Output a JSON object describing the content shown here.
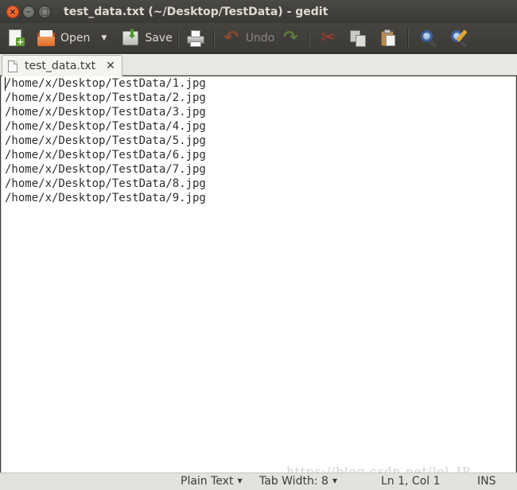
{
  "window": {
    "title": "test_data.txt (~/Desktop/TestData) - gedit",
    "close_glyph": "×",
    "minimize_glyph": "–",
    "maximize_glyph": "□"
  },
  "toolbar": {
    "new_icon": "new-document-icon",
    "open_label": "Open",
    "open_dropdown_glyph": "▼",
    "save_label": "Save",
    "undo_label": "Undo",
    "undo_glyph": "↶",
    "redo_glyph": "↷",
    "cut_glyph": "✂",
    "plus_glyph": "+"
  },
  "tab": {
    "label": "test_data.txt",
    "close_glyph": "✕"
  },
  "editor": {
    "lines": [
      "/home/x/Desktop/TestData/1.jpg",
      "/home/x/Desktop/TestData/2.jpg",
      "/home/x/Desktop/TestData/3.jpg",
      "/home/x/Desktop/TestData/4.jpg",
      "/home/x/Desktop/TestData/5.jpg",
      "/home/x/Desktop/TestData/6.jpg",
      "/home/x/Desktop/TestData/7.jpg",
      "/home/x/Desktop/TestData/8.jpg",
      "/home/x/Desktop/TestData/9.jpg"
    ]
  },
  "statusbar": {
    "language": "Plain Text",
    "tab_width": "Tab Width: 8",
    "position": "Ln 1, Col 1",
    "mode": "INS",
    "dropdown_glyph": "▼",
    "watermark": "https://blog.csdn.net/lol_IP"
  }
}
